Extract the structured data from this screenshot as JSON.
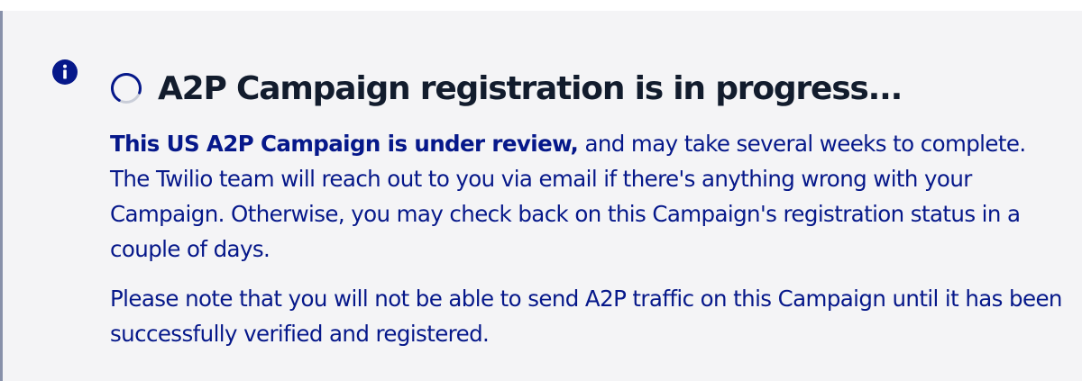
{
  "colors": {
    "accent_bar": "#8891aa",
    "background": "#f4f4f6",
    "title_text": "#121c2d",
    "body_text": "#06188a",
    "info_icon": "#06188a",
    "spinner_arc": "#06188a",
    "spinner_track": "#c9cdd8"
  },
  "icons": {
    "status": "info-icon",
    "progress": "spinner-icon"
  },
  "alert": {
    "title": "A2P Campaign registration is in progress...",
    "paragraph1_bold": "This US A2P Campaign is under review,",
    "paragraph1_rest": " and may take several weeks to complete. The Twilio team will reach out to you via email if there's anything wrong with your Campaign. Otherwise, you may check back on this Campaign's registration status in a couple of days.",
    "paragraph2": "Please note that you will not be able to send A2P traffic on this Campaign until it has been successfully verified and registered."
  }
}
